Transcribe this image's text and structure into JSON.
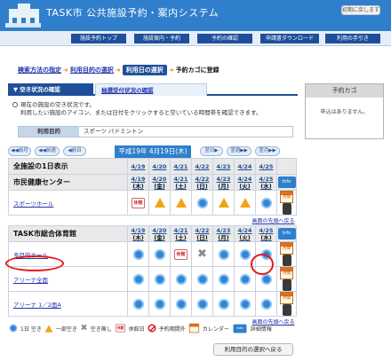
{
  "header": {
    "title": "TASK市 公共施設予約・案内システム",
    "reset_label": "初期に戻します"
  },
  "nav": {
    "items": [
      "施設予約トップ",
      "施設案内・予約",
      "予約の確認",
      "申請書ダウンロード",
      "利用の手引き"
    ]
  },
  "breadcrumb": {
    "step1": "検索方法の指定",
    "step2": "利用目的の選択",
    "current": "利用日の選択",
    "next": "予約カゴに登録"
  },
  "tabs": {
    "active": "空き状況の確認",
    "inactive": "抽選受付状況の確認"
  },
  "cart": {
    "title": "予約カゴ",
    "empty_text": "申込はありません。"
  },
  "notice": {
    "line1": "現在の施設の空き状況です。",
    "line2": "利用したい施設のアイコン、または日付をクリックすると空いている時間帯を確認できます。"
  },
  "purpose": {
    "label": "利用目的",
    "value": "スポーツ バドミントン"
  },
  "date_nav": {
    "prev_month": "前月",
    "prev_week": "前週",
    "prev_day": "前日",
    "current_date": "平成19年 4月19日(木)",
    "next_day": "翌日",
    "next_week": "翌週",
    "next_month": "翌月"
  },
  "dates": [
    {
      "d": "4/19",
      "w": "(木)"
    },
    {
      "d": "4/20",
      "w": "(金)"
    },
    {
      "d": "4/21",
      "w": "(土)"
    },
    {
      "d": "4/22",
      "w": "(日)"
    },
    {
      "d": "4/23",
      "w": "(月)"
    },
    {
      "d": "4/24",
      "w": "(火)"
    },
    {
      "d": "4/25",
      "w": "(水)"
    }
  ],
  "all_facilities_label": "全施設の1日表示",
  "facility1": {
    "name": "市民健康センター",
    "info_label": "Info",
    "rooms": [
      {
        "name": "スポーツホール",
        "status": [
          "kyu",
          "tri",
          "tri",
          "circle",
          "tri",
          "tri",
          "circle"
        ]
      }
    ]
  },
  "facility2": {
    "name": "TASK市総合体育館",
    "info_label": "Info",
    "rooms": [
      {
        "name": "多目的ホール",
        "status": [
          "circle",
          "circle",
          "kyu",
          "x",
          "circle",
          "circle",
          "circle"
        ]
      },
      {
        "name": "アリーナ全面",
        "status": [
          "circle",
          "circle",
          "circle",
          "circle",
          "circle",
          "circle",
          "circle"
        ]
      },
      {
        "name": "アリーナ 1／2面A",
        "status": [
          "circle",
          "circle",
          "circle",
          "circle",
          "circle",
          "circle",
          "circle"
        ]
      }
    ]
  },
  "month_label": "月間",
  "back_to_top": "画面の先頭へ戻る",
  "legend": {
    "available": "空き",
    "partial": "一部空き",
    "full": "空き無し",
    "closed": "休館日",
    "out_of_period": "予約期間外",
    "calendar": "カレンダー",
    "details": "詳細情報"
  },
  "legend_prefix": {
    "available": "1日",
    "info": "Info"
  },
  "kyu_icon": "休館",
  "back_button": "利用目的の選択へ戻る",
  "colors": {
    "header": "#2f7fcc",
    "nav_button": "#1f4f9a",
    "available": "#2f86d8",
    "partial": "#f2a21a",
    "highlight_circle": "#e01a1a"
  }
}
